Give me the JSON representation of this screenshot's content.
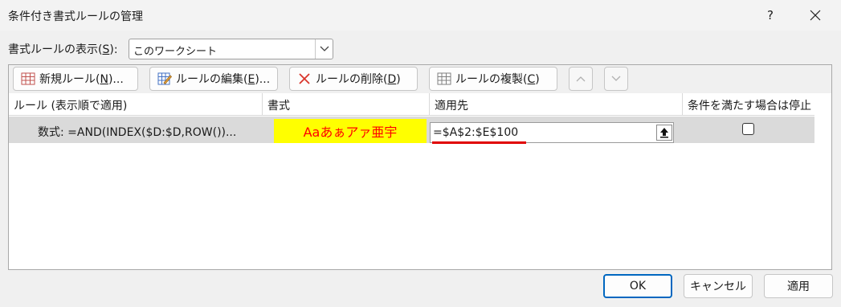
{
  "window": {
    "title": "条件付き書式ルールの管理",
    "help": "?",
    "close_icon": "close-icon"
  },
  "show_rules": {
    "label_prefix": "書式ルールの表示(",
    "label_key": "S",
    "label_suffix": "):",
    "selected": "このワークシート"
  },
  "toolbar": {
    "new_rule": {
      "prefix": "新規ルール(",
      "key": "N",
      "suffix": ")..."
    },
    "edit_rule": {
      "prefix": "ルールの編集(",
      "key": "E",
      "suffix": ")..."
    },
    "delete_rule": {
      "prefix": "ルールの削除(",
      "key": "D",
      "suffix": ")"
    },
    "duplicate_rule": {
      "prefix": "ルールの複製(",
      "key": "C",
      "suffix": ")"
    }
  },
  "grid": {
    "columns": [
      "ルール (表示順で適用)",
      "書式",
      "適用先",
      "条件を満たす場合は停止"
    ],
    "rows": [
      {
        "rule": "数式: =AND(INDEX($D:$D,ROW())...",
        "format_preview": "Aaあぁアァ亜宇",
        "applies_to": "=$A$2:$E$100",
        "stop_if_true": false
      }
    ]
  },
  "footer": {
    "ok": "OK",
    "cancel": "キャンセル",
    "apply": "適用"
  },
  "colors": {
    "format_background": "#ffff00",
    "format_text": "#ff0000",
    "annotation_underline": "#e00000",
    "ok_border": "#0067c0"
  }
}
